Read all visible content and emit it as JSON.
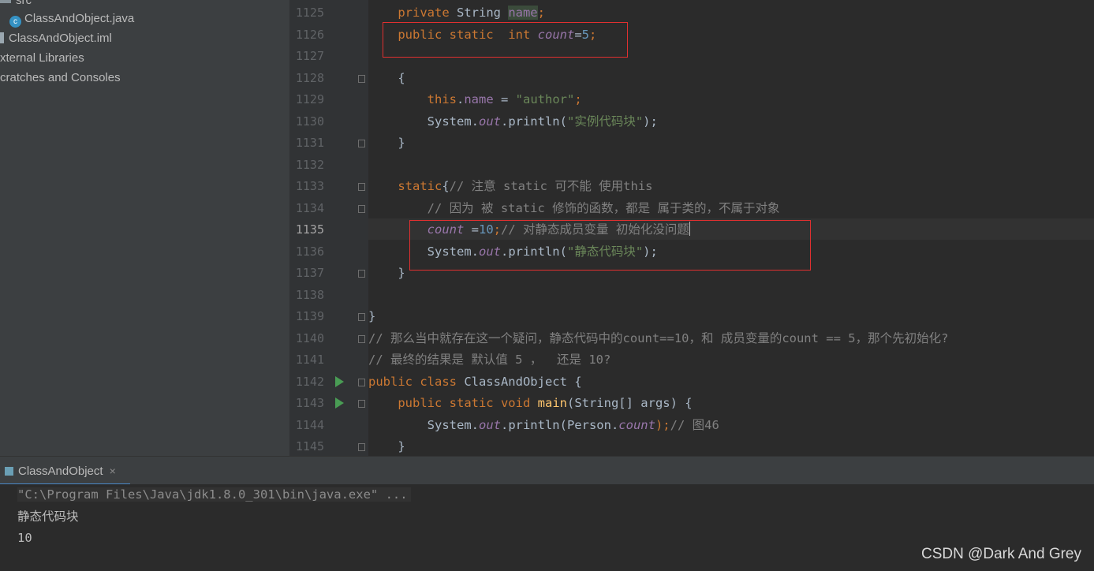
{
  "project_tree": {
    "items": [
      {
        "label": "src",
        "icon": "folder-icon"
      },
      {
        "label": "ClassAndObject.java",
        "icon": "java-class-icon"
      },
      {
        "label": "ClassAndObject.iml",
        "icon": "iml-file-icon"
      },
      {
        "label": "xternal Libraries"
      },
      {
        "label": "cratches and Consoles"
      }
    ]
  },
  "editor": {
    "current_line": "1135",
    "lines": [
      {
        "n": "1125",
        "segments": [
          {
            "t": "    "
          },
          {
            "t": "private",
            "c": "kw"
          },
          {
            "t": " String "
          },
          {
            "t": "name",
            "c": "fld hl"
          },
          {
            "t": ";",
            "c": "kw"
          }
        ]
      },
      {
        "n": "1126",
        "segments": [
          {
            "t": "    "
          },
          {
            "t": "public static  int",
            "c": "kw"
          },
          {
            "t": " "
          },
          {
            "t": "count",
            "c": "sfld"
          },
          {
            "t": "="
          },
          {
            "t": "5",
            "c": "num"
          },
          {
            "t": ";",
            "c": "kw"
          }
        ]
      },
      {
        "n": "1127",
        "segments": []
      },
      {
        "n": "1128",
        "segments": [
          {
            "t": "    {"
          }
        ]
      },
      {
        "n": "1129",
        "segments": [
          {
            "t": "        "
          },
          {
            "t": "this",
            "c": "kw"
          },
          {
            "t": "."
          },
          {
            "t": "name",
            "c": "fld"
          },
          {
            "t": " = "
          },
          {
            "t": "\"author\"",
            "c": "str"
          },
          {
            "t": ";",
            "c": "kw"
          }
        ]
      },
      {
        "n": "1130",
        "segments": [
          {
            "t": "        System."
          },
          {
            "t": "out",
            "c": "sfld"
          },
          {
            "t": ".println("
          },
          {
            "t": "\"实例代码块\"",
            "c": "str"
          },
          {
            "t": ");"
          }
        ]
      },
      {
        "n": "1131",
        "segments": [
          {
            "t": "    }"
          }
        ]
      },
      {
        "n": "1132",
        "segments": []
      },
      {
        "n": "1133",
        "segments": [
          {
            "t": "    "
          },
          {
            "t": "static",
            "c": "kw"
          },
          {
            "t": "{"
          },
          {
            "t": "// 注意 static 可不能 使用this",
            "c": "cmt"
          }
        ]
      },
      {
        "n": "1134",
        "segments": [
          {
            "t": "        "
          },
          {
            "t": "// 因为 被 static 修饰的函数，都是 属于类的，不属于对象",
            "c": "cmt"
          }
        ]
      },
      {
        "n": "1135",
        "segments": [
          {
            "t": "        "
          },
          {
            "t": "count",
            "c": "sfld"
          },
          {
            "t": " ="
          },
          {
            "t": "10",
            "c": "num"
          },
          {
            "t": ";",
            "c": "kw"
          },
          {
            "t": "// 对静态成员变量 初始化没问题",
            "c": "cmt"
          }
        ]
      },
      {
        "n": "1136",
        "segments": [
          {
            "t": "        System."
          },
          {
            "t": "out",
            "c": "sfld"
          },
          {
            "t": ".println("
          },
          {
            "t": "\"静态代码块\"",
            "c": "str"
          },
          {
            "t": ");"
          }
        ]
      },
      {
        "n": "1137",
        "segments": [
          {
            "t": "    }"
          }
        ]
      },
      {
        "n": "1138",
        "segments": []
      },
      {
        "n": "1139",
        "segments": [
          {
            "t": "}"
          }
        ]
      },
      {
        "n": "1140",
        "segments": [
          {
            "t": "// 那么当中就存在这一个疑问，静态代码中的count==10，和 成员变量的count == 5，那个先初始化?",
            "c": "cmt"
          }
        ]
      },
      {
        "n": "1141",
        "segments": [
          {
            "t": "// 最终的结果是 默认值 5 ，  还是 10?",
            "c": "cmt"
          }
        ]
      },
      {
        "n": "1142",
        "segments": [
          {
            "t": "public class",
            "c": "kw"
          },
          {
            "t": " ClassAndObject {"
          }
        ]
      },
      {
        "n": "1143",
        "segments": [
          {
            "t": "    "
          },
          {
            "t": "public static void",
            "c": "kw"
          },
          {
            "t": " "
          },
          {
            "t": "main",
            "c": "fn"
          },
          {
            "t": "(String[] args) {"
          }
        ]
      },
      {
        "n": "1144",
        "segments": [
          {
            "t": "        System."
          },
          {
            "t": "out",
            "c": "sfld"
          },
          {
            "t": ".println(Person."
          },
          {
            "t": "count",
            "c": "sfld"
          },
          {
            "t": ");",
            "c": "kw"
          },
          {
            "t": "// 图46",
            "c": "cmt"
          }
        ]
      },
      {
        "n": "1145",
        "segments": [
          {
            "t": "    }"
          }
        ]
      }
    ]
  },
  "run_panel": {
    "tab_label": "ClassAndObject",
    "close_glyph": "×",
    "command": "\"C:\\Program Files\\Java\\jdk1.8.0_301\\bin\\java.exe\" ...",
    "output": [
      "静态代码块",
      "10"
    ]
  },
  "watermark": "CSDN @Dark And Grey",
  "colors": {
    "keyword": "#cc7832",
    "field": "#9876aa",
    "string": "#6a8759",
    "number": "#6897bb",
    "comment": "#808080",
    "highlight_box": "#e03030"
  }
}
